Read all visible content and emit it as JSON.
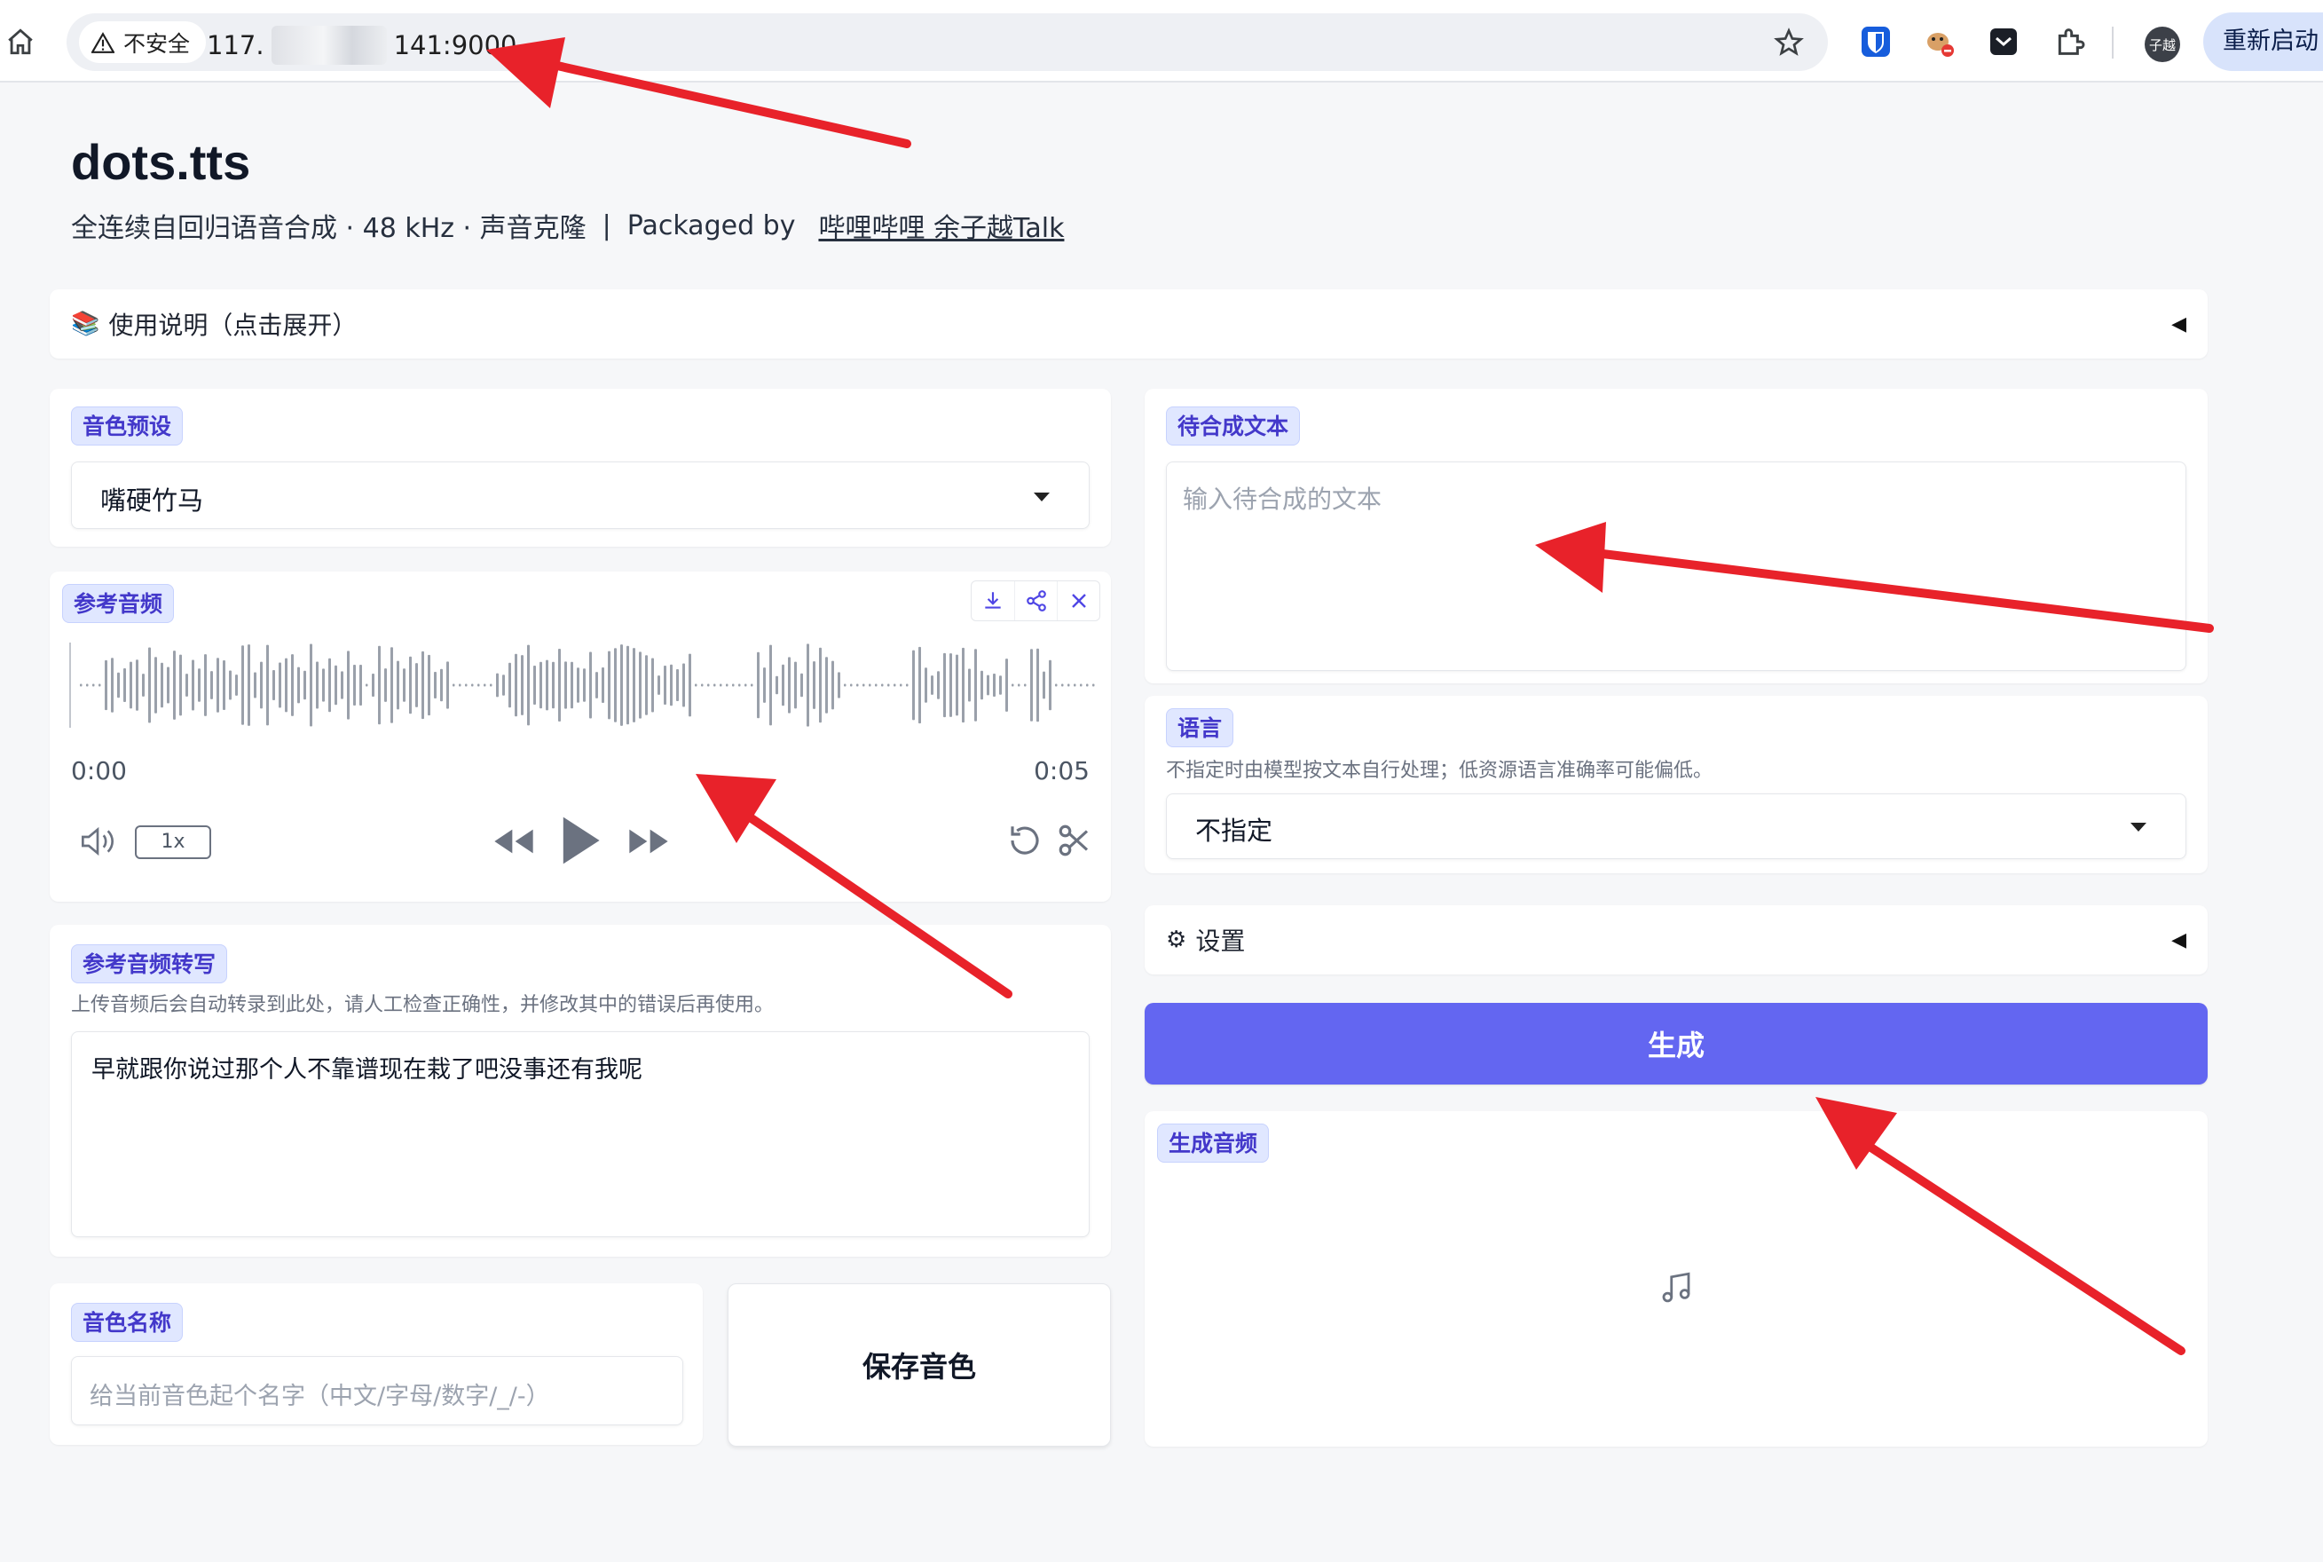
{
  "browser": {
    "insecure_label": "不安全",
    "url_prefix": "117.",
    "url_suffix": "141:9000",
    "restart_label": "重新启动",
    "profile_initials": "子越"
  },
  "header": {
    "title": "dots.tts",
    "subtitle": "全连续自回归语音合成 · 48 kHz · 声音克隆",
    "separator": "|",
    "packaged_by": "Packaged by",
    "author_link": "哔哩哔哩 余子越Talk"
  },
  "instructions": {
    "icon": "📚",
    "label": "使用说明（点击展开）",
    "caret": "◀"
  },
  "voice_preset": {
    "label": "音色预设",
    "value": "嘴硬竹马"
  },
  "reference_audio": {
    "label": "参考音频",
    "time_start": "0:00",
    "time_end": "0:05",
    "speed": "1x",
    "progress": 0.0
  },
  "transcript": {
    "label": "参考音频转写",
    "hint": "上传音频后会自动转录到此处，请人工检查正确性，并修改其中的错误后再使用。",
    "value": "早就跟你说过那个人不靠谱现在栽了吧没事还有我呢"
  },
  "voice_name": {
    "label": "音色名称",
    "placeholder": "给当前音色起个名字（中文/字母/数字/_/-）"
  },
  "save_voice_label": "保存音色",
  "synth_text": {
    "label": "待合成文本",
    "placeholder": "输入待合成的文本"
  },
  "language": {
    "label": "语言",
    "hint": "不指定时由模型按文本自行处理；低资源语言准确率可能偏低。",
    "value": "不指定"
  },
  "settings": {
    "icon": "⚙",
    "label": "设置",
    "caret": "◀"
  },
  "generate_label": "生成",
  "output_audio": {
    "label": "生成音频"
  },
  "colors": {
    "accent": "#6366f1",
    "tag_bg": "#e0e7ff",
    "tag_text": "#4338ca",
    "annotation_arrow": "#e8222a",
    "waveform": "#9aa0aa"
  }
}
